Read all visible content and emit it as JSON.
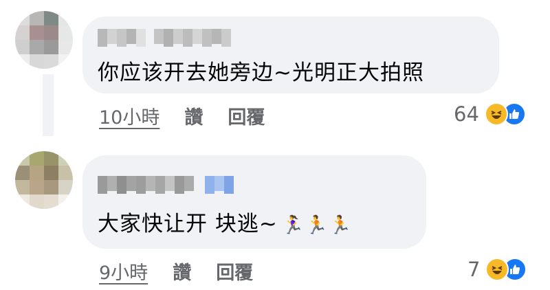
{
  "comments": [
    {
      "text": "你应该开去她旁边~光明正大拍照",
      "time": "10小時",
      "like_label": "讚",
      "reply_label": "回覆",
      "reaction_count": "64",
      "avatar_colors": [
        "#dcdcdc",
        "#b9b6b6",
        "#7f8a87",
        "#e4e6e6",
        "#d7d2d2",
        "#a89090",
        "#9c8a8a",
        "#e6e8e8",
        "#cfcfcf",
        "#a9a9a9",
        "#9a9a9a",
        "#e8e8e8",
        "#ededed",
        "#d8d8d8",
        "#dadada",
        "#f2f2f2"
      ],
      "name_colors": [
        "#b8b8b8",
        "#d2d2d2",
        "#c6c6c6",
        "#b4b4b4",
        "#e0e0e0",
        "#c4c4c4",
        "#b1b1b1",
        "#cdcdcd",
        "#bcbcbc",
        "#d5d5d5",
        "#c0c0c0",
        "#b6b6b6",
        "#cbcbcb"
      ]
    },
    {
      "text": "大家快让开 块逃~",
      "runners": "🏃‍♀️🏃🏃",
      "time": "9小時",
      "like_label": "讚",
      "reply_label": "回覆",
      "reaction_count": "7",
      "avatar_colors": [
        "#c7c9a9",
        "#a7a870",
        "#97946a",
        "#cfd0b8",
        "#9c8f77",
        "#b6a582",
        "#8d7f63",
        "#c8c1a7",
        "#c3b79d",
        "#b9a58a",
        "#a8987d",
        "#d8d3c7",
        "#eeeae3",
        "#e1d9cc",
        "#e5ddd1",
        "#f4f1ec"
      ],
      "name_colors": [
        "#9a9a9a",
        "#b0b0b0",
        "#8f8f8f",
        "#a3a3a3",
        "#9d9d9d",
        "#b5b5b5",
        "#a6a6a6",
        "#c4c4c4",
        "#999999",
        "#ababab",
        "#8fb2ea",
        "#a9c4f1",
        "#7ea4e6"
      ]
    }
  ],
  "colors": {
    "bubble": "#f0f2f5",
    "meta_text": "#65676b",
    "like_blue": "#1877f2",
    "haha_yellow": "#f7b928"
  },
  "icons": {
    "haha": "laughing-face-icon",
    "like": "thumbs-up-icon"
  }
}
